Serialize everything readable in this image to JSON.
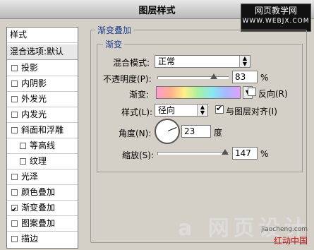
{
  "window": {
    "title": "图层样式"
  },
  "watermark_top": {
    "line1": "网页教学网",
    "line2": "WWW.WEBJX.COM"
  },
  "sidebar": {
    "header": "样式",
    "blend_options": "混合选项:默认",
    "items": [
      {
        "label": "投影",
        "checked": false
      },
      {
        "label": "内阴影",
        "checked": false
      },
      {
        "label": "外发光",
        "checked": false
      },
      {
        "label": "内发光",
        "checked": false
      },
      {
        "label": "斜面和浮雕",
        "checked": false
      },
      {
        "label": "等高线",
        "checked": false
      },
      {
        "label": "纹理",
        "checked": false
      },
      {
        "label": "光泽",
        "checked": false
      },
      {
        "label": "颜色叠加",
        "checked": false
      },
      {
        "label": "渐变叠加",
        "checked": true
      },
      {
        "label": "图案叠加",
        "checked": false
      },
      {
        "label": "描边",
        "checked": false
      }
    ]
  },
  "panel": {
    "group_title": "渐变叠加",
    "subgroup_title": "渐变",
    "blend_mode_label": "混合模式:",
    "blend_mode_value": "正常",
    "opacity_label": "不透明度(P):",
    "opacity_value": "83",
    "opacity_unit": "%",
    "gradient_label": "渐变:",
    "reverse_label": "反向(R)",
    "reverse_checked": false,
    "style_label": "样式(L):",
    "style_value": "径向",
    "align_label": "与图层对齐(I)",
    "align_checked": true,
    "angle_label": "角度(N):",
    "angle_value": "23",
    "angle_unit": "度",
    "scale_label": "缩放(S):",
    "scale_value": "147",
    "scale_unit": "%"
  },
  "watermark_bottom": {
    "logo": "a 网页设计",
    "small": "jiaocheng.com",
    "red": "红动中国"
  }
}
